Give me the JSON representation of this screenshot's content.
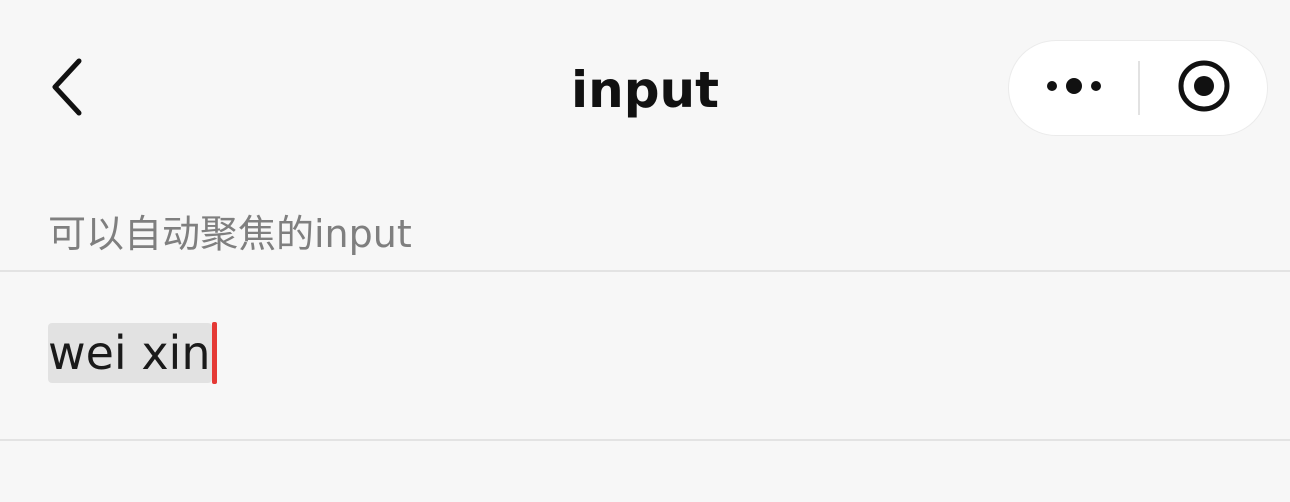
{
  "navbar": {
    "title": "input",
    "back_icon": "chevron-left-icon",
    "more_icon": "more-dots-icon",
    "close_icon": "target-circle-icon"
  },
  "section": {
    "label": "可以自动聚焦的input"
  },
  "input": {
    "value": "wei xin",
    "caret_color": "#e53935"
  },
  "colors": {
    "background": "#f7f7f7",
    "title": "#111111",
    "label": "#7f7f7f",
    "divider": "#e3e3e3",
    "composing_highlight": "#e2e2e2"
  }
}
